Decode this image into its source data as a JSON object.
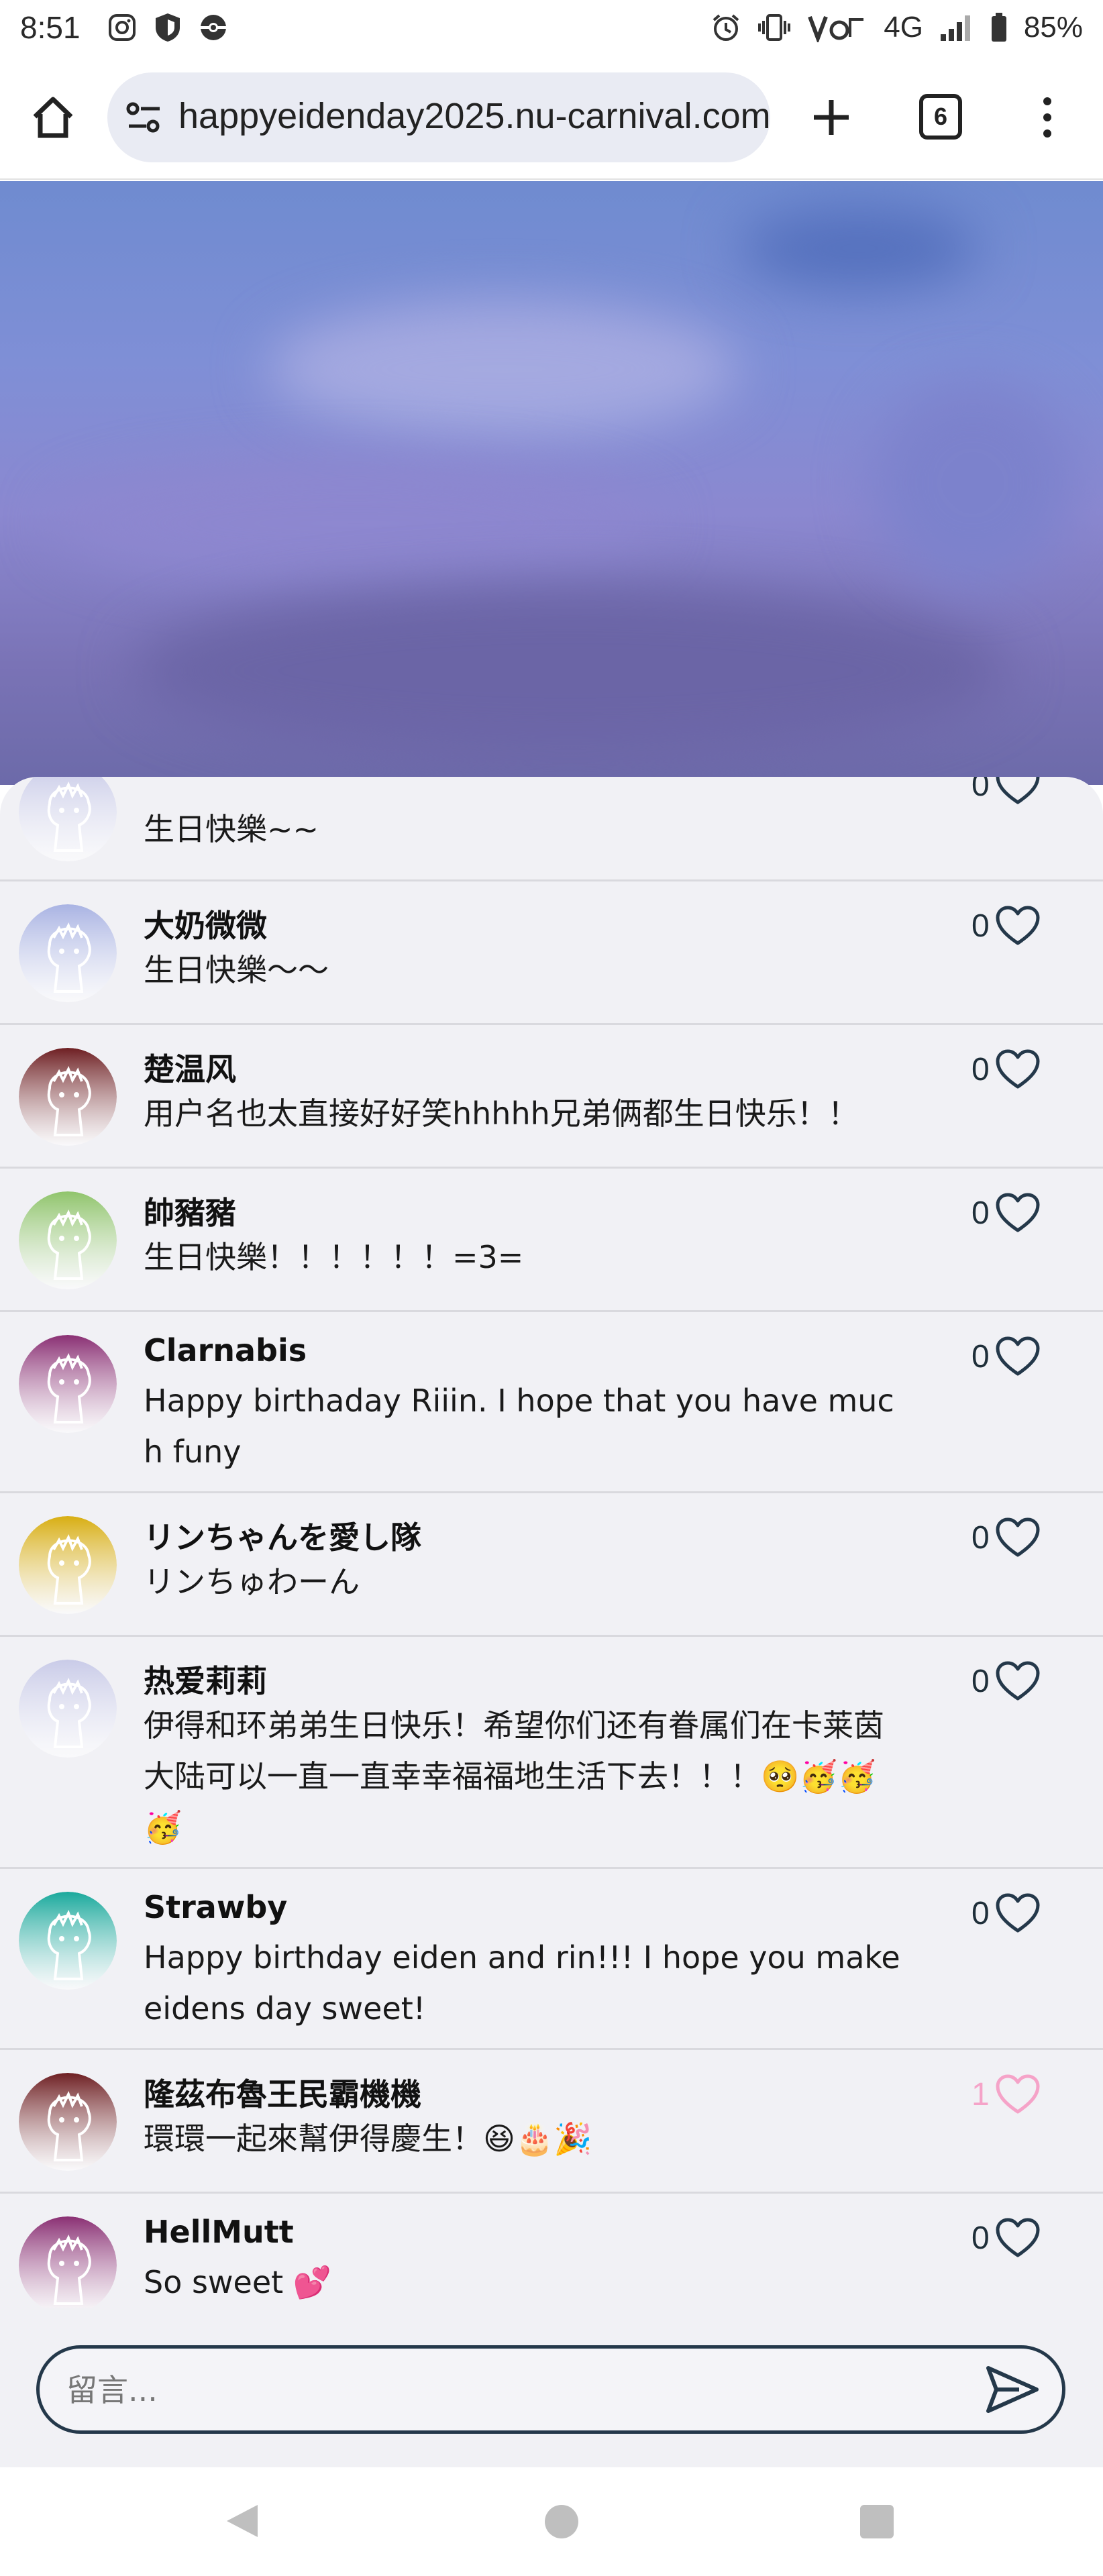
{
  "status_bar": {
    "time": "8:51",
    "network": "4G",
    "battery": "85%",
    "icons_left": [
      "instagram-icon",
      "shield-icon",
      "pokeball-icon"
    ],
    "icons_right": [
      "alarm-icon",
      "vibrate-icon",
      "volte-icon",
      "signal-icon",
      "battery-icon"
    ]
  },
  "browser": {
    "url": "happyeidenday2025.nu-carnival.com",
    "tab_count": "6"
  },
  "comments": [
    {
      "name": "",
      "text": "生日快樂~~",
      "likes": "0",
      "liked": false,
      "avatar_color": "#c9cbe8"
    },
    {
      "name": "大奶微微",
      "text": "生日快樂～～",
      "likes": "0",
      "liked": false,
      "avatar_color": "#a9b3e3"
    },
    {
      "name": "楚温风",
      "text": "用户名也太直接好好笑hhhhh兄弟俩都生日快乐！！",
      "likes": "0",
      "liked": false,
      "avatar_color": "#6e1f22"
    },
    {
      "name": "帥豬豬",
      "text": "生日快樂！！！！！！=3=",
      "likes": "0",
      "liked": false,
      "avatar_color": "#8fc46b"
    },
    {
      "name": "Clarnabis",
      "text": "Happy birthaday Riiin. I hope that you have much funy",
      "likes": "0",
      "liked": false,
      "avatar_color": "#8a2f73"
    },
    {
      "name": "リンちゃんを愛し隊",
      "text": "リンちゅわーん",
      "likes": "0",
      "liked": false,
      "avatar_color": "#d8ae12"
    },
    {
      "name": "热爱莉莉",
      "text": "伊得和环弟弟生日快乐！希望你们还有眷属们在卡莱茵大陆可以一直一直幸幸福福地生活下去！！！🥺🥳🥳🥳",
      "likes": "0",
      "liked": false,
      "avatar_color": "#c9cbe8"
    },
    {
      "name": "Strawby",
      "text": "Happy birthday eiden and rin!!! I hope you make eidens day sweet!",
      "likes": "0",
      "liked": false,
      "avatar_color": "#1aa99c"
    },
    {
      "name": "隆茲布魯王民霸機機",
      "text": "環環一起來幫伊得慶生！😆🎂🎉",
      "likes": "1",
      "liked": true,
      "avatar_color": "#6e1f22"
    },
    {
      "name": "HellMutt",
      "text": "So sweet 💕",
      "likes": "0",
      "liked": false,
      "avatar_color": "#8a2f73"
    }
  ],
  "comment_input": {
    "placeholder": "留言..."
  },
  "colors": {
    "accent": "#24384a",
    "heart_liked": "#f5a3c8",
    "panel_bg": "#f1f1f5"
  }
}
